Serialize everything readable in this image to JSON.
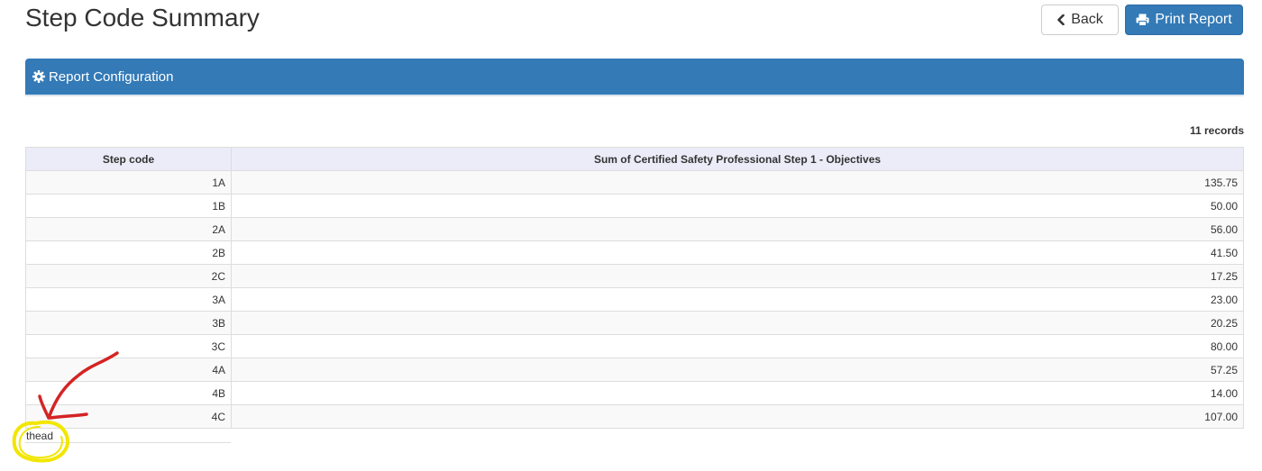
{
  "header": {
    "title": "Step Code Summary",
    "back_label": "Back",
    "print_label": "Print Report"
  },
  "panel": {
    "title": "Report Configuration"
  },
  "records": {
    "count_label": "11 records"
  },
  "table": {
    "columns": [
      "Step code",
      "Sum of Certified Safety Professional Step 1 - Objectives"
    ],
    "rows": [
      {
        "code": "1A",
        "sum": "135.75"
      },
      {
        "code": "1B",
        "sum": "50.00"
      },
      {
        "code": "2A",
        "sum": "56.00"
      },
      {
        "code": "2B",
        "sum": "41.50"
      },
      {
        "code": "2C",
        "sum": "17.25"
      },
      {
        "code": "3A",
        "sum": "23.00"
      },
      {
        "code": "3B",
        "sum": "20.25"
      },
      {
        "code": "3C",
        "sum": "80.00"
      },
      {
        "code": "4A",
        "sum": "57.25"
      },
      {
        "code": "4B",
        "sum": "14.00"
      },
      {
        "code": "4C",
        "sum": "107.00"
      }
    ]
  },
  "annotation": {
    "label": "thead",
    "arrow_color": "#d42424",
    "circle_color": "#f2e600"
  },
  "icons": {
    "back": "chevron-left-icon",
    "print": "printer-icon",
    "panel": "gear-icon"
  },
  "colors": {
    "primary": "#337ab7",
    "header_bg": "#ececf9"
  }
}
